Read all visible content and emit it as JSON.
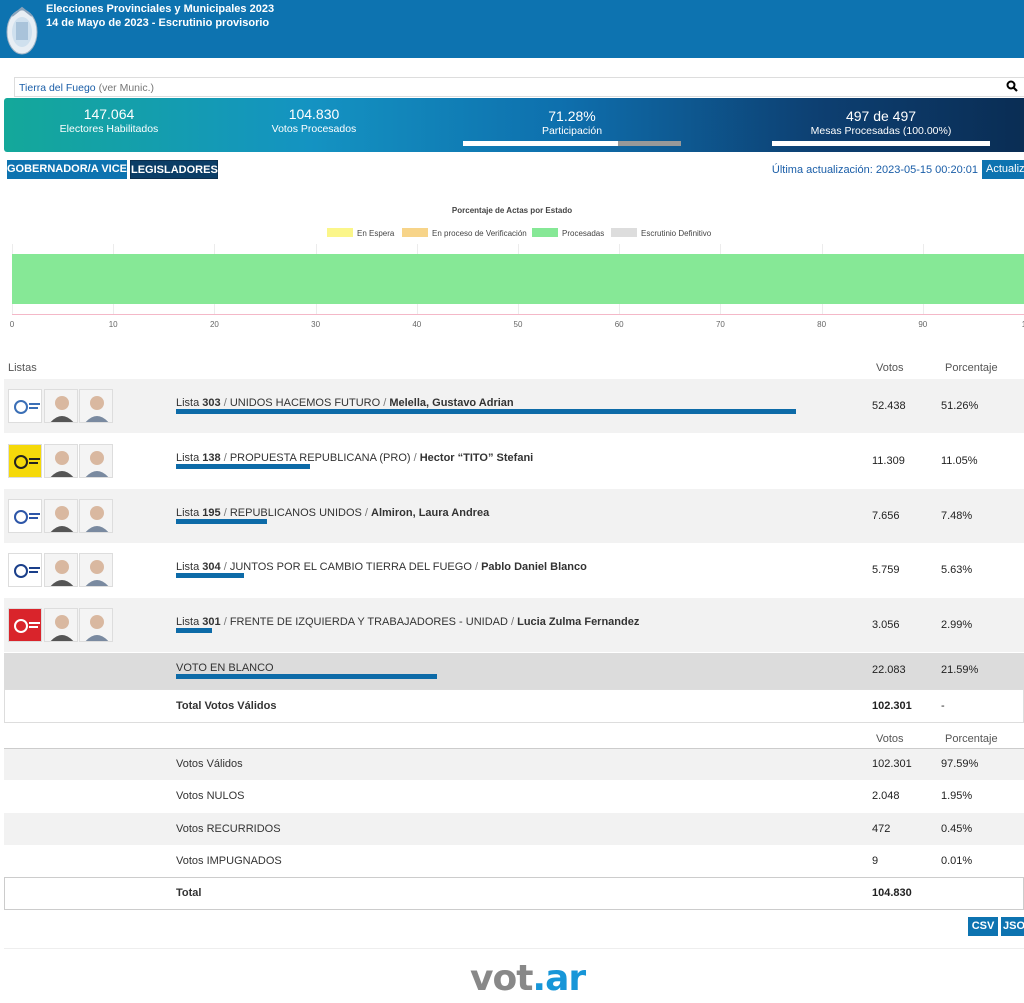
{
  "header": {
    "line1": "Elecciones Provinciales y Municipales 2023",
    "line2": "14 de Mayo de 2023 - Escrutinio provisorio",
    "seal_icon": "provincial-seal-icon"
  },
  "search": {
    "region": "Tierra del Fuego",
    "region_sub": "(ver Munic.)",
    "icon": "search-icon"
  },
  "stats": {
    "electores_value": "147.064",
    "electores_label": "Electores Habilitados",
    "votos_value": "104.830",
    "votos_label": "Votos Procesados",
    "participacion_value": "71.28%",
    "participacion_label": "Participación",
    "participacion_fraction": 0.7128,
    "mesas_value": "497 de 497",
    "mesas_label": "Mesas Procesadas (100.00%)",
    "mesas_fraction": 1.0
  },
  "tabs": {
    "gobernador": "GOBERNADOR/A VICE",
    "legisladores": "LEGISLADORES"
  },
  "update": {
    "text": "Última actualización: 2023-05-15 00:20:01",
    "button": "Actualiz"
  },
  "chart_data": {
    "type": "bar",
    "title": "Porcentaje de Actas por Estado",
    "legend": [
      "En Espera",
      "En proceso de Verificación",
      "Procesadas",
      "Escrutinio Definitivo"
    ],
    "colors": [
      "#fbf68a",
      "#f7d489",
      "#86e896",
      "#dddddd"
    ],
    "series": [
      {
        "name": "En Espera",
        "values": [
          0
        ]
      },
      {
        "name": "En proceso de Verificación",
        "values": [
          0
        ]
      },
      {
        "name": "Procesadas",
        "values": [
          100
        ]
      },
      {
        "name": "Escrutinio Definitivo",
        "values": [
          0
        ]
      }
    ],
    "xticks": [
      "0",
      "10",
      "20",
      "30",
      "40",
      "50",
      "60",
      "70",
      "80",
      "90",
      "1"
    ],
    "xlim": [
      0,
      100
    ],
    "orientation": "horizontal",
    "stacked": true
  },
  "table": {
    "col_listas": "Listas",
    "col_votos": "Votos",
    "col_porcentaje": "Porcentaje",
    "rows": [
      {
        "lista_word": "Lista",
        "num": "303",
        "name": "UNIDOS HACEMOS FUTURO",
        "cand": "Melella, Gustavo Adrian",
        "votos": "52.438",
        "pct": "51.26%",
        "share": 0.5126
      },
      {
        "lista_word": "Lista",
        "num": "138",
        "name": "PROPUESTA REPUBLICANA (PRO)",
        "cand": "Hector “TITO” Stefani",
        "votos": "11.309",
        "pct": "11.05%",
        "share": 0.1105
      },
      {
        "lista_word": "Lista",
        "num": "195",
        "name": "REPUBLICANOS UNIDOS",
        "cand": "Almiron, Laura Andrea",
        "votos": "7.656",
        "pct": "7.48%",
        "share": 0.0748
      },
      {
        "lista_word": "Lista",
        "num": "304",
        "name": "JUNTOS POR EL CAMBIO TIERRA DEL FUEGO",
        "cand": "Pablo Daniel Blanco",
        "votos": "5.759",
        "pct": "5.63%",
        "share": 0.0563
      },
      {
        "lista_word": "Lista",
        "num": "301",
        "name": "FRENTE DE IZQUIERDA Y TRABAJADORES - UNIDAD",
        "cand": "Lucia Zulma Fernandez",
        "votos": "3.056",
        "pct": "2.99%",
        "share": 0.0299
      }
    ],
    "blanco": {
      "label": "VOTO EN BLANCO",
      "votos": "22.083",
      "pct": "21.59%",
      "share": 0.2159
    },
    "total_validos": {
      "label": "Total Votos Válidos",
      "votos": "102.301",
      "pct": "-"
    }
  },
  "summary": {
    "col_votos": "Votos",
    "col_porcentaje": "Porcentaje",
    "rows": [
      {
        "label": "Votos Válidos",
        "votos": "102.301",
        "pct": "97.59%"
      },
      {
        "label": "Votos NULOS",
        "votos": "2.048",
        "pct": "1.95%"
      },
      {
        "label": "Votos RECURRIDOS",
        "votos": "472",
        "pct": "0.45%"
      },
      {
        "label": "Votos IMPUGNADOS",
        "votos": "9",
        "pct": "0.01%"
      }
    ],
    "total": {
      "label": "Total",
      "votos": "104.830"
    }
  },
  "downloads": {
    "csv": "CSV",
    "json": "JSO"
  },
  "footer": {
    "brand_a": "vot",
    "brand_dot": ".",
    "brand_b": "ar"
  }
}
